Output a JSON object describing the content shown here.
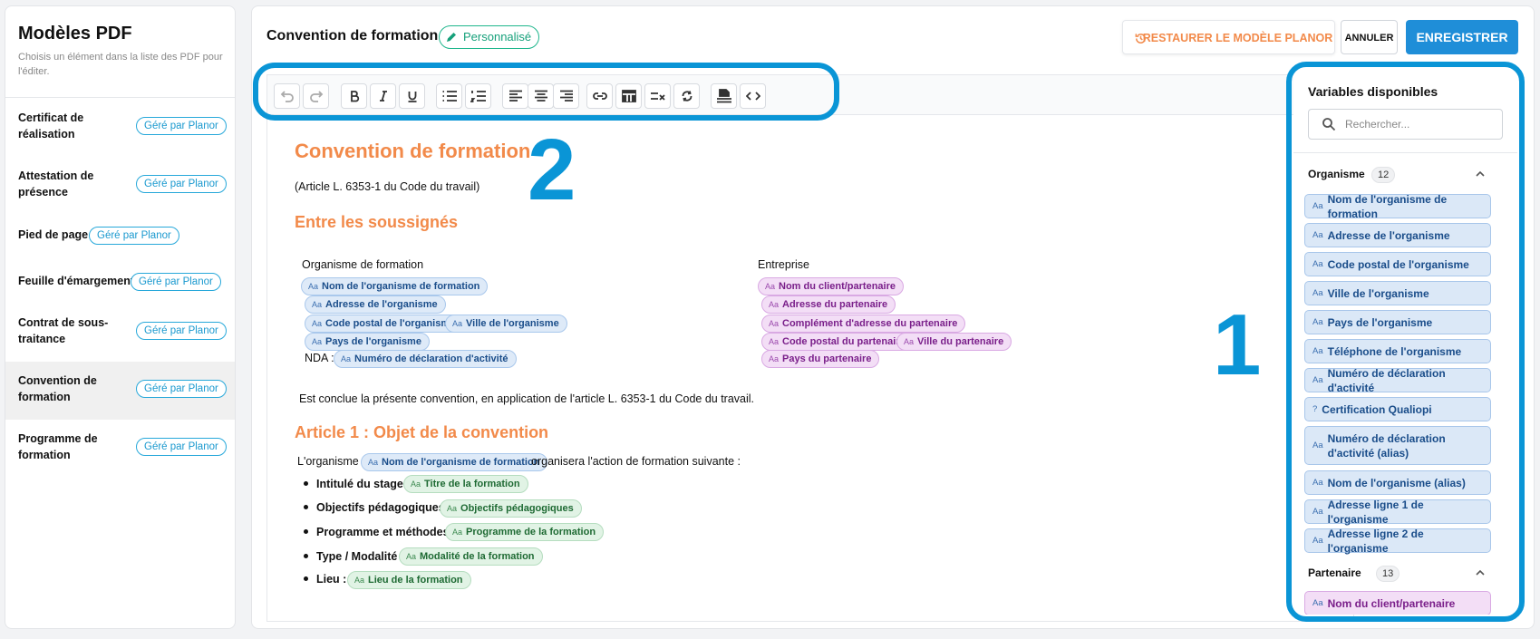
{
  "sidebar": {
    "title": "Modèles PDF",
    "subtitle": "Choisis un élément dans la liste des PDF pour l'éditer.",
    "items": [
      {
        "label": "Certificat de réalisation",
        "badge": "Géré par Planor"
      },
      {
        "label": "Attestation de présence",
        "badge": "Géré par Planor"
      },
      {
        "label": "Pied de page",
        "badge": "Géré par Planor"
      },
      {
        "label": "Feuille d'émargement",
        "badge": "Géré par Planor"
      },
      {
        "label": "Contrat de sous-traitance",
        "badge": "Géré par Planor"
      },
      {
        "label": "Convention de formation",
        "badge": "Géré par Planor"
      },
      {
        "label": "Programme de formation",
        "badge": "Géré par Planor"
      }
    ]
  },
  "header": {
    "title": "Convention de formation",
    "status_badge": "Personnalisé",
    "restore_label": "RESTAURER LE MODÈLE PLANOR",
    "cancel_label": "ANNULER",
    "save_label": "ENREGISTRER"
  },
  "annotations": {
    "toolbar_number": "2",
    "variables_number": "1"
  },
  "chip_icon": "Aa",
  "doc": {
    "title": "Convention de formation",
    "article_ref": "(Article L. 6353-1 du Code du travail)",
    "section_parties": "Entre les soussignés",
    "org_heading": "Organisme de formation",
    "ent_heading": "Entreprise",
    "org_chips": [
      "Nom de l'organisme de formation",
      "Adresse de l'organisme",
      "Code postal de l'organisme",
      "Ville de l'organisme",
      "Pays de l'organisme",
      "Numéro de déclaration d'activité"
    ],
    "nda_label": "NDA :",
    "ent_chips": [
      "Nom du client/partenaire",
      "Adresse du partenaire",
      "Complément d'adresse du partenaire",
      "Code postal du partenaire",
      "Ville du partenaire",
      "Pays du partenaire"
    ],
    "conclusion": "Est conclue la présente convention, en application de l'article L. 6353-1 du Code du travail.",
    "article1_title": "Article 1 : Objet de la convention",
    "article1_intro_before": "L'organisme",
    "article1_intro_chip": "Nom de l'organisme de formation",
    "article1_intro_after": "organisera l'action de formation suivante :",
    "bullets": [
      {
        "label": "Intitulé du stage :",
        "chip": "Titre de la formation"
      },
      {
        "label": "Objectifs pédagogiques :",
        "chip": "Objectifs pédagogiques"
      },
      {
        "label": "Programme et méthodes :",
        "chip": "Programme de la formation"
      },
      {
        "label": "Type / Modalité :",
        "chip": "Modalité de la formation"
      },
      {
        "label": "Lieu :",
        "chip": "Lieu de la formation"
      }
    ]
  },
  "variables": {
    "title": "Variables disponibles",
    "search_placeholder": "Rechercher...",
    "groups": [
      {
        "name": "Organisme",
        "count": "12",
        "items": [
          {
            "icon": "Aa",
            "label": "Nom de l'organisme de formation"
          },
          {
            "icon": "Aa",
            "label": "Adresse de l'organisme"
          },
          {
            "icon": "Aa",
            "label": "Code postal de l'organisme"
          },
          {
            "icon": "Aa",
            "label": "Ville de l'organisme"
          },
          {
            "icon": "Aa",
            "label": "Pays de l'organisme"
          },
          {
            "icon": "Aa",
            "label": "Téléphone de l'organisme"
          },
          {
            "icon": "Aa",
            "label": "Numéro de déclaration d'activité"
          },
          {
            "icon": "?",
            "label": "Certification Qualiopi"
          },
          {
            "icon": "Aa",
            "label": "Numéro de déclaration d'activité (alias)"
          },
          {
            "icon": "Aa",
            "label": "Nom de l'organisme (alias)"
          },
          {
            "icon": "Aa",
            "label": "Adresse ligne 1 de l'organisme"
          },
          {
            "icon": "Aa",
            "label": "Adresse ligne 2 de l'organisme"
          }
        ]
      },
      {
        "name": "Partenaire",
        "count": "13",
        "items": [
          {
            "icon": "Aa",
            "label": "Nom du client/partenaire"
          }
        ]
      }
    ]
  },
  "colors": {
    "accent": "#1f8ed8",
    "highlight": "#0a95d6",
    "heading": "#f28a4a",
    "personnalise": "#15a07a"
  }
}
